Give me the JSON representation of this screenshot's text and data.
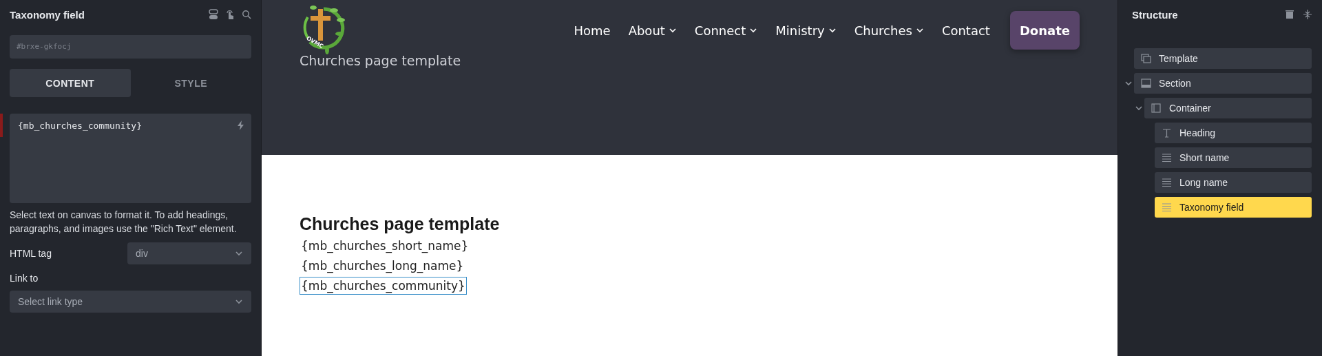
{
  "settings_panel": {
    "title": "Taxonomy field",
    "element_id": "#brxe-gkfocj",
    "tabs": [
      {
        "label": "CONTENT",
        "selected": true
      },
      {
        "label": "STYLE",
        "selected": false
      }
    ],
    "text_value": "{mb_churches_community}",
    "help_text": "Select text on canvas to format it. To add headings, paragraphs, and images use the \"Rich Text\" element.",
    "html_tag": {
      "label": "HTML tag",
      "value": "div"
    },
    "link_to": {
      "label": "Link to",
      "placeholder": "Select link type"
    }
  },
  "canvas": {
    "header": {
      "logo_text": "OVMC",
      "site_title": "Churches page template",
      "nav": [
        {
          "label": "Home",
          "dropdown": false
        },
        {
          "label": "About",
          "dropdown": true
        },
        {
          "label": "Connect",
          "dropdown": true
        },
        {
          "label": "Ministry",
          "dropdown": true
        },
        {
          "label": "Churches",
          "dropdown": true
        },
        {
          "label": "Contact",
          "dropdown": false
        }
      ],
      "cta": "Donate"
    },
    "heading": "Churches page template",
    "lines": [
      {
        "text": "{mb_churches_short_name}",
        "selected": false
      },
      {
        "text": "{mb_churches_long_name}",
        "selected": false
      },
      {
        "text": "{mb_churches_community}",
        "selected": true
      }
    ]
  },
  "structure": {
    "title": "Structure",
    "items": [
      {
        "label": "Template",
        "kind": "template",
        "selected": false
      },
      {
        "label": "Section",
        "kind": "section",
        "selected": false,
        "expanded": true,
        "children": [
          {
            "label": "Container",
            "kind": "container",
            "selected": false,
            "expanded": true,
            "children": [
              {
                "label": "Heading",
                "kind": "heading",
                "selected": false
              },
              {
                "label": "Short name",
                "kind": "text",
                "selected": false
              },
              {
                "label": "Long name",
                "kind": "text",
                "selected": false
              },
              {
                "label": "Taxonomy field",
                "kind": "text",
                "selected": true
              }
            ]
          }
        ]
      }
    ]
  }
}
